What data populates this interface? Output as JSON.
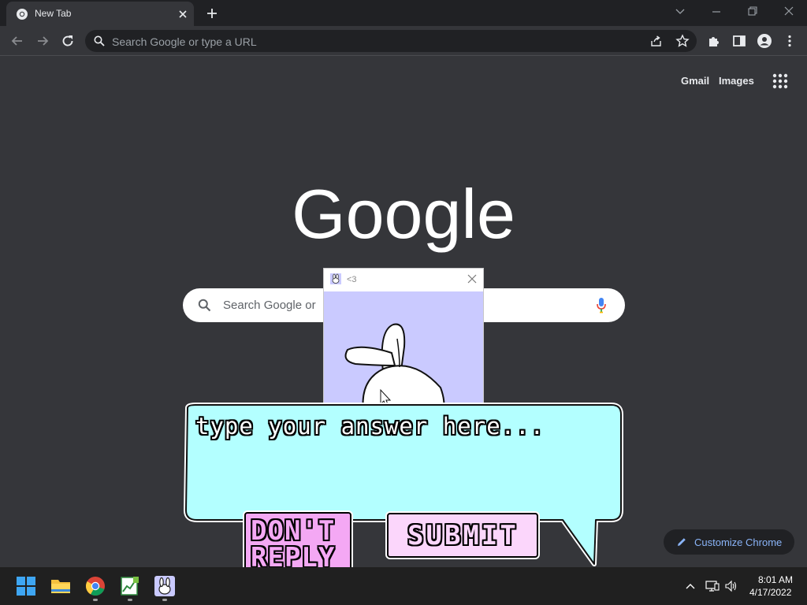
{
  "browser": {
    "tab_title": "New Tab",
    "omnibox_placeholder": "Search Google or type a URL"
  },
  "ntp": {
    "gmail_label": "Gmail",
    "images_label": "Images",
    "logo_text": "Google",
    "search_placeholder": "Search Google or",
    "customize_label": "Customize Chrome"
  },
  "popup": {
    "title": "<3"
  },
  "bubble": {
    "answer_placeholder": "type your answer here...",
    "dont_reply_line1": "DON'T",
    "dont_reply_line2": "REPLY",
    "submit_label": "SUBMIT"
  },
  "taskbar": {
    "time": "8:01 AM",
    "date": "4/17/2022"
  },
  "colors": {
    "page_bg": "#35363a",
    "bubble_fill": "#b3ffff",
    "dont_reply_fill": "#f4a8f4",
    "submit_fill": "#fbd6fb",
    "popup_bg": "#cacaff",
    "link_blue": "#8ab4f8"
  }
}
